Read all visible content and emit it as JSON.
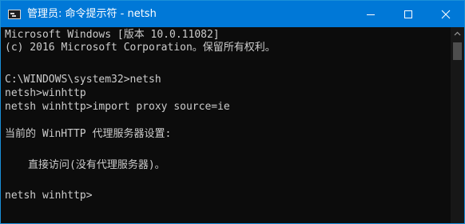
{
  "window": {
    "title": "管理员: 命令提示符 - netsh",
    "icon": "cmd-icon"
  },
  "controls": {
    "minimize": "minimize-icon",
    "maximize": "maximize-icon",
    "close": "close-icon"
  },
  "console": {
    "lines": [
      "Microsoft Windows [版本 10.0.11082]",
      "(c) 2016 Microsoft Corporation。保留所有权利。",
      "C:\\WINDOWS\\system32>netsh",
      "netsh>winhttp",
      "netsh winhttp>import proxy source=ie",
      "当前的 WinHTTP 代理服务器设置:",
      "直接访问(没有代理服务器)。",
      "netsh winhttp>"
    ]
  },
  "colors": {
    "titlebar": "#0078d7",
    "console_background": "#0c0c0c",
    "console_text": "#cccccc"
  }
}
